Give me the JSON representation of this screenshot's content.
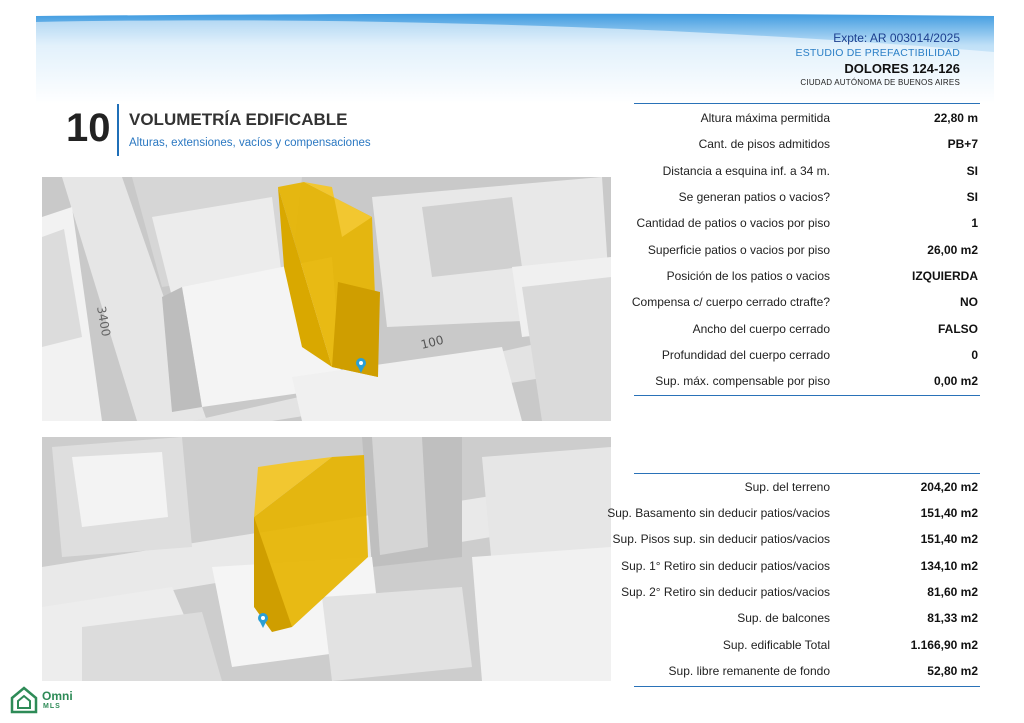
{
  "header": {
    "expediente": "Expte: AR 003014/2025",
    "estudio": "ESTUDIO DE PREFACTIBILIDAD",
    "address": "DOLORES 124-126",
    "city": "CIUDAD AUTÓNOMA DE BUENOS AIRES"
  },
  "section": {
    "number": "10",
    "title": "VOLUMETRÍA EDIFICABLE",
    "subtitle": "Alturas, extensiones, vacíos y compensaciones"
  },
  "maps": {
    "street_label_1": "3400",
    "street_label_2": "100"
  },
  "table1": [
    {
      "label": "Altura máxima permitida",
      "value": "22,80 m"
    },
    {
      "label": "Cant. de pisos admitidos",
      "value": "PB+7"
    },
    {
      "label": "Distancia a esquina inf. a 34 m.",
      "value": "SI"
    },
    {
      "label": "Se generan patios o vacios?",
      "value": "SI"
    },
    {
      "label": "Cantidad de patios o vacios por piso",
      "value": "1"
    },
    {
      "label": "Superficie patios o vacios por piso",
      "value": "26,00 m2"
    },
    {
      "label": "Posición de los patios o vacios",
      "value": "IZQUIERDA"
    },
    {
      "label": "Compensa c/ cuerpo cerrado ctrafte?",
      "value": "NO"
    },
    {
      "label": "Ancho del  cuerpo cerrado",
      "value": "FALSO"
    },
    {
      "label": "Profundidad del  cuerpo cerrado",
      "value": "0"
    },
    {
      "label": "Sup. máx. compensable por piso",
      "value": "0,00 m2"
    }
  ],
  "table2": [
    {
      "label": "Sup. del terreno",
      "value": "204,20 m2"
    },
    {
      "label": "Sup. Basamento sin deducir patios/vacios",
      "value": "151,40 m2"
    },
    {
      "label": "Sup. Pisos sup. sin deducir patios/vacios",
      "value": "151,40 m2"
    },
    {
      "label": "Sup. 1° Retiro sin deducir patios/vacios",
      "value": "134,10 m2"
    },
    {
      "label": "Sup. 2° Retiro sin deducir patios/vacios",
      "value": "81,60 m2"
    },
    {
      "label": "Sup. de balcones",
      "value": "81,33 m2"
    },
    {
      "label": "Sup. edificable Total",
      "value": "1.166,90 m2"
    },
    {
      "label": "Sup. libre remanente de fondo",
      "value": "52,80 m2"
    }
  ],
  "logo": {
    "word": "Omni",
    "sub": "MLS",
    "icon": "house-logo-icon",
    "color": "#2e8b57"
  },
  "colors": {
    "accent_blue": "#2a72b8",
    "building_highlight": "#e6b400",
    "location_pin": "#2a9fd6"
  }
}
